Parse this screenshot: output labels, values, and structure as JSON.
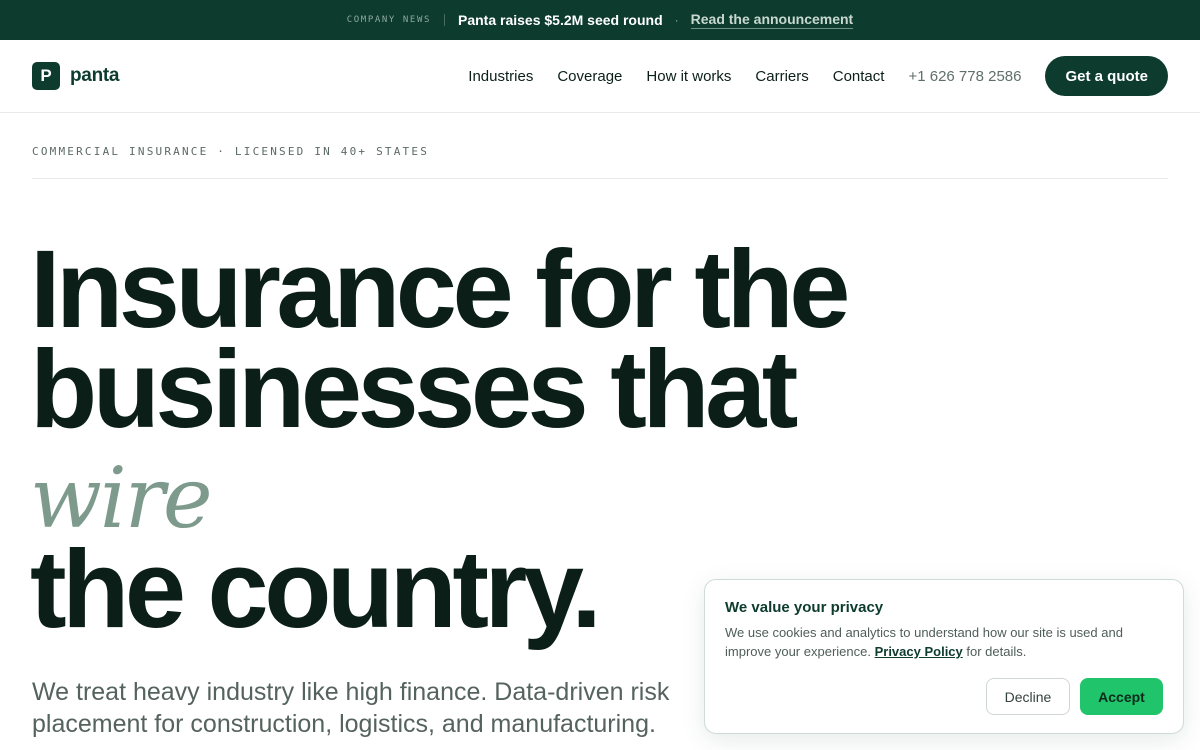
{
  "announcement": {
    "tag": "COMPANY NEWS",
    "headline": "Panta raises $5.2M seed round",
    "separator": "·",
    "link": "Read the announcement"
  },
  "nav": {
    "logo_letter": "P",
    "brand": "panta",
    "links": [
      "Industries",
      "Coverage",
      "How it works",
      "Carriers",
      "Contact"
    ],
    "phone": "+1 626 778 2586",
    "cta": "Get a quote"
  },
  "hero": {
    "eyebrow": "COMMERCIAL INSURANCE · LICENSED IN 40+ STATES",
    "title_line1": "Insurance for the",
    "title_line2": "businesses that",
    "title_accent": "wire",
    "title_line3": "the country.",
    "subtitle": "We treat heavy industry like high finance. Data-driven risk placement for construction, logistics, and manufacturing."
  },
  "cookie": {
    "title": "We value your privacy",
    "body_before": "We use cookies and analytics to understand how our site is used and improve your experience.",
    "policy_link": "Privacy Policy",
    "body_after": "for details.",
    "decline": "Decline",
    "accept": "Accept"
  },
  "colors": {
    "brand_dark": "#0d3b2e",
    "accent_green": "#1fc46b",
    "accent_sage": "#7d9a8d"
  }
}
